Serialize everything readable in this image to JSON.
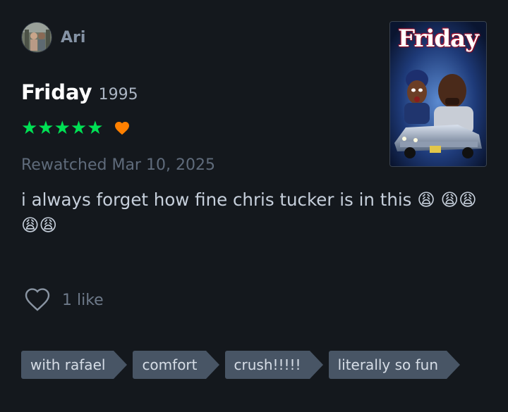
{
  "user": {
    "name": "Ari",
    "avatar_icon": "avatar-photo"
  },
  "film": {
    "title": "Friday",
    "year": "1995",
    "poster_title": "Friday"
  },
  "rating": {
    "stars": "★★★★★",
    "value": 5,
    "max": 5,
    "liked": true,
    "liked_icon": "heart-filled-icon",
    "star_color": "#00e054",
    "heart_color": "#ff8000"
  },
  "watched": {
    "text": "Rewatched Mar 10, 2025"
  },
  "review": {
    "text": "i always forget how fine chris tucker is in this 😩 😩😩😩😩"
  },
  "likes": {
    "icon": "heart-outline-icon",
    "count_text": "1 like"
  },
  "tags": [
    {
      "label": "with rafael"
    },
    {
      "label": "comfort"
    },
    {
      "label": "crush!!!!!"
    },
    {
      "label": "literally so fun"
    }
  ]
}
